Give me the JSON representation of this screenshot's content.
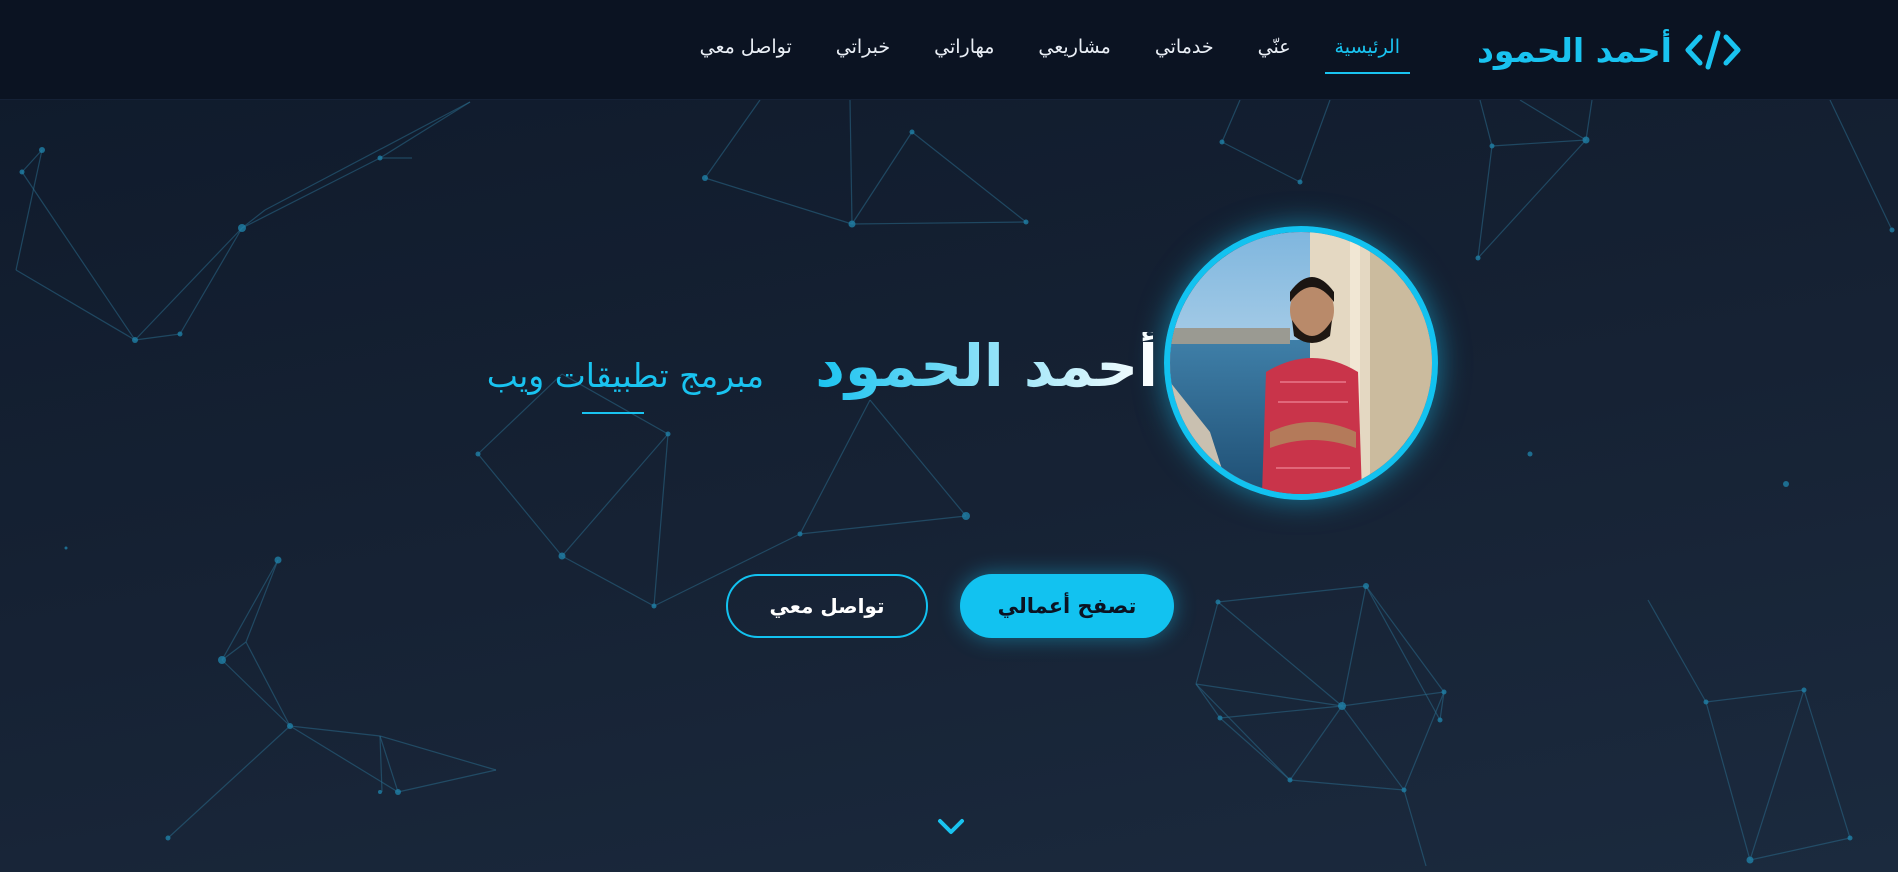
{
  "brand": {
    "name": "أحمد الحمود",
    "icon": "code-brackets-icon"
  },
  "nav": {
    "items": [
      {
        "label": "الرئيسية",
        "active": true
      },
      {
        "label": "عنّي",
        "active": false
      },
      {
        "label": "خدماتي",
        "active": false
      },
      {
        "label": "مشاريعي",
        "active": false
      },
      {
        "label": "مهاراتي",
        "active": false
      },
      {
        "label": "خبراتي",
        "active": false
      },
      {
        "label": "تواصل معي",
        "active": false
      }
    ]
  },
  "hero": {
    "name": "أحمد الحمود",
    "role": "مبرمج تطبيقات ويب",
    "primary_button": "تصفح أعمالي",
    "secondary_button": "تواصل معي",
    "scroll_icon": "chevron-down-icon"
  },
  "colors": {
    "accent": "#19c3f0",
    "background": "#142031",
    "navbar": "#0b1322"
  }
}
